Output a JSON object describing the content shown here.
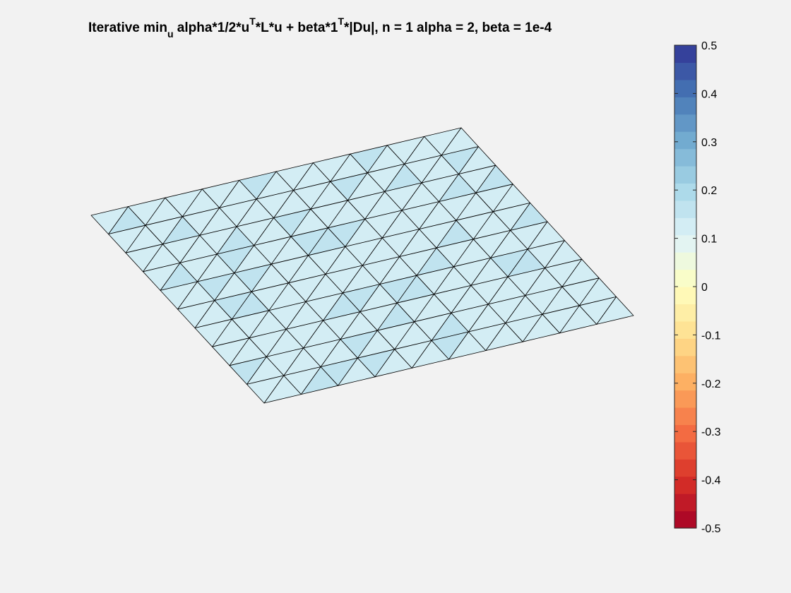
{
  "chart_data": {
    "type": "heatmap",
    "subtype": "trisurf-mesh-with-colorbar",
    "title": {
      "prefix": "Iterative min",
      "subscript": "u",
      "mid1": " alpha*1/2*u",
      "sup1": "T",
      "mid2": "*L*u + beta*1",
      "sup2": "T",
      "suffix": "*|Du|,  n = 1 alpha = 2, beta = 1e-4"
    },
    "mesh": {
      "divisions": 10,
      "triangulation": "right-triangles with diagonals",
      "value_min": 0.11,
      "value_max": 0.15
    },
    "colorbar": {
      "clim": [
        -0.5,
        0.5
      ],
      "levels": 28,
      "ticks": [
        0.5,
        0.4,
        0.3,
        0.2,
        0.1,
        0,
        -0.1,
        -0.2,
        -0.3,
        -0.4,
        -0.5
      ],
      "tick_labels": [
        "0.5",
        "0.4",
        "0.3",
        "0.2",
        "0.1",
        "0",
        "-0.1",
        "-0.2",
        "-0.3",
        "-0.4",
        "-0.5"
      ],
      "colormap_stops": [
        "#a50026",
        "#d73027",
        "#f46d43",
        "#fdae61",
        "#fee090",
        "#ffffbf",
        "#e0f3f8",
        "#abd9e9",
        "#74add1",
        "#4575b4",
        "#313695"
      ]
    },
    "grid": false,
    "legend": "none"
  },
  "colors": {
    "background": "#f2f2f2",
    "edges": "#000000"
  }
}
